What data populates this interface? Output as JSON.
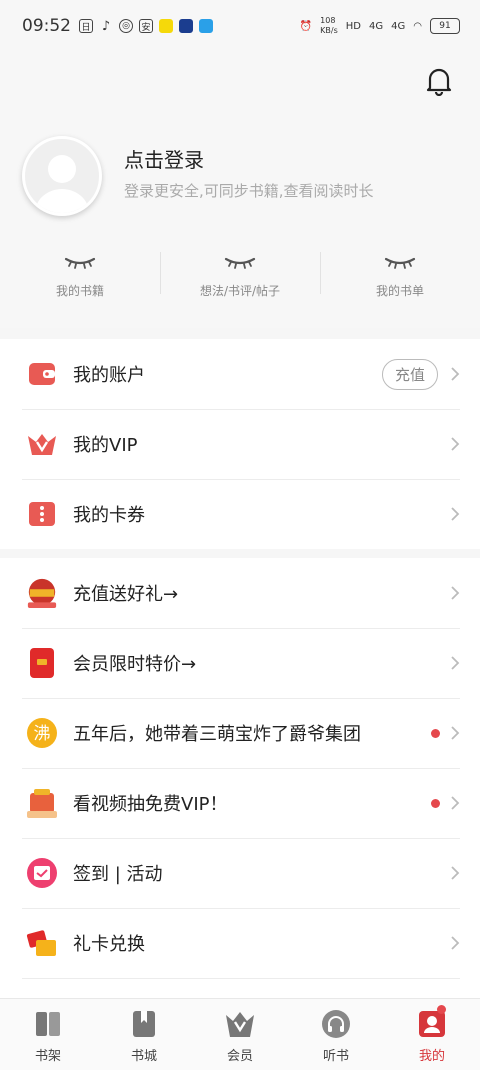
{
  "status": {
    "time": "09:52",
    "net_speed": "108\nKB/s",
    "battery": "91",
    "signal1": "4G",
    "signal2": "4G"
  },
  "profile": {
    "login_title": "点击登录",
    "login_subtitle": "登录更安全,可同步书籍,查看阅读时长"
  },
  "stats": [
    {
      "label": "我的书籍"
    },
    {
      "label": "想法/书评/帖子"
    },
    {
      "label": "我的书单"
    }
  ],
  "account_group": [
    {
      "label": "我的账户",
      "action": "充值",
      "icon": "wallet-icon"
    },
    {
      "label": "我的VIP",
      "icon": "vip-crown-icon"
    },
    {
      "label": "我的卡券",
      "icon": "coupon-icon"
    }
  ],
  "promo_group": [
    {
      "label": "充值送好礼→",
      "icon": "gift-badge-icon"
    },
    {
      "label": "会员限时特价→",
      "icon": "red-envelope-icon"
    },
    {
      "label": "五年后，她带着三萌宝炸了爵爷集团",
      "icon": "fei-char-icon",
      "dot": true
    },
    {
      "label": "看视频抽免费VIP！",
      "icon": "video-vip-icon",
      "dot": true
    },
    {
      "label": "签到 | 活动",
      "icon": "calendar-icon"
    },
    {
      "label": "礼卡兑换",
      "icon": "gift-card-icon"
    }
  ],
  "tabs": [
    {
      "label": "书架",
      "icon": "bookshelf-icon"
    },
    {
      "label": "书城",
      "icon": "bookstore-icon"
    },
    {
      "label": "会员",
      "icon": "vip-icon"
    },
    {
      "label": "听书",
      "icon": "headphones-icon"
    },
    {
      "label": "我的",
      "icon": "profile-icon",
      "active": true
    }
  ],
  "colors": {
    "accent": "#d6363b",
    "icon_red": "#e85a54",
    "gold": "#f0b429"
  }
}
